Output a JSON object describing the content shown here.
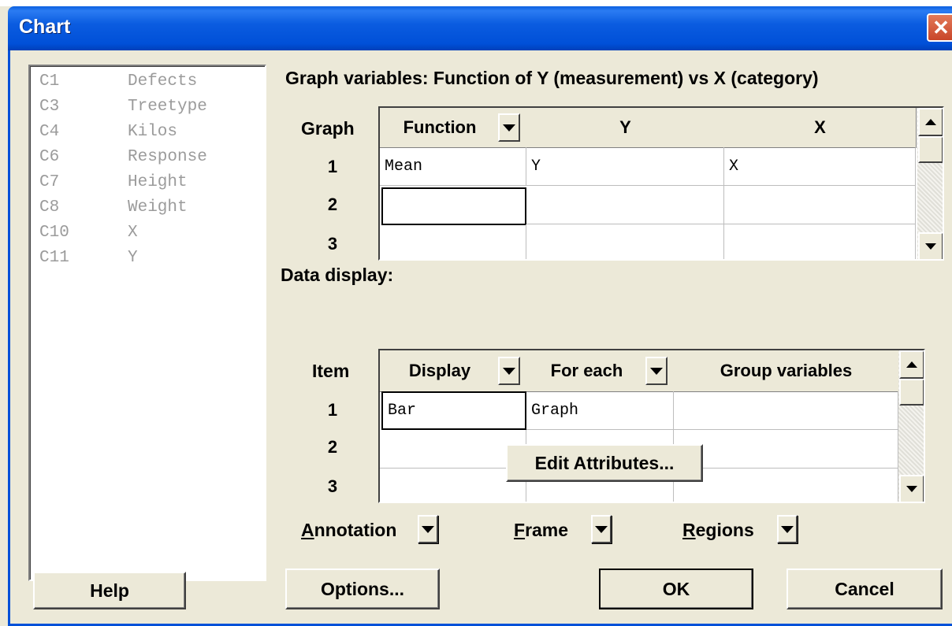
{
  "window": {
    "title": "Chart",
    "close_glyph": "✕"
  },
  "variables": [
    {
      "col": "C1",
      "name": "Defects"
    },
    {
      "col": "C3",
      "name": "Treetype"
    },
    {
      "col": "C4",
      "name": "Kilos"
    },
    {
      "col": "C6",
      "name": "Response"
    },
    {
      "col": "C7",
      "name": "Height"
    },
    {
      "col": "C8",
      "name": "Weight"
    },
    {
      "col": "C10",
      "name": "X"
    },
    {
      "col": "C11",
      "name": "Y"
    }
  ],
  "graph_vars": {
    "label": "Graph variables:  Function of Y (measurement) vs X (category)",
    "row_header": "Graph",
    "columns": [
      "Function",
      "Y",
      "X"
    ],
    "row_numbers": [
      "1",
      "2",
      "3"
    ],
    "rows": [
      {
        "function": "Mean",
        "y": "Y",
        "x": "X"
      },
      {
        "function": "",
        "y": "",
        "x": ""
      },
      {
        "function": "",
        "y": "",
        "x": ""
      }
    ]
  },
  "data_display": {
    "label": "Data display:",
    "row_header": "Item",
    "columns": [
      "Display",
      "For each",
      "Group variables"
    ],
    "row_numbers": [
      "1",
      "2",
      "3"
    ],
    "rows": [
      {
        "display": "Bar",
        "for_each": "Graph",
        "group": ""
      },
      {
        "display": "",
        "for_each": "",
        "group": ""
      },
      {
        "display": "",
        "for_each": "",
        "group": ""
      }
    ],
    "edit_attributes": "Edit Attributes..."
  },
  "dropdowns": {
    "annotation_first": "A",
    "annotation_rest": "nnotation",
    "frame_first": "F",
    "frame_rest": "rame",
    "regions_first": "R",
    "regions_rest": "egions"
  },
  "buttons": {
    "help": "Help",
    "options": "Options...",
    "ok": "OK",
    "cancel": "Cancel"
  }
}
